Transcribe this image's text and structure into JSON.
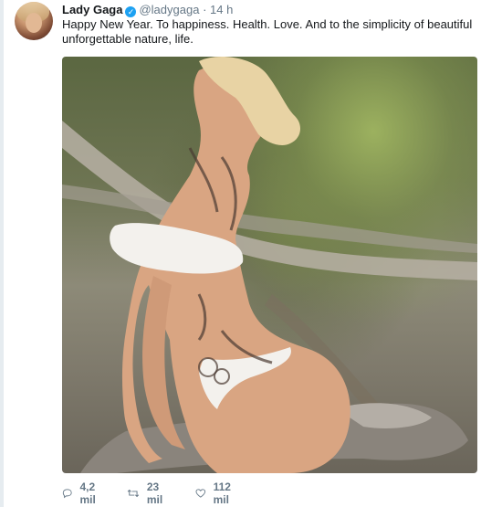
{
  "tweet": {
    "display_name": "Lady Gaga",
    "handle": "@ladygaga",
    "separator": "·",
    "time": "14 h",
    "text": "Happy New Year. To happiness. Health. Love. And to the simplicity of beautiful unforgettable nature, life.",
    "verified_icon": "verified-badge-icon"
  },
  "actions": {
    "reply_count": "4,2 mil",
    "retweet_count": "23 mil",
    "like_count": "112 mil"
  },
  "colors": {
    "text": "#14171a",
    "secondary": "#657786",
    "verified": "#1da1f2"
  }
}
